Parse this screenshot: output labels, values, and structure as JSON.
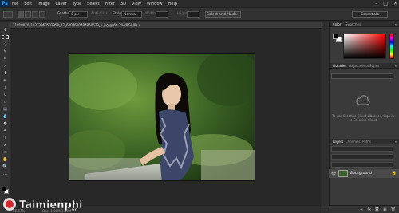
{
  "app": {
    "logo": "Ps"
  },
  "menu": [
    "File",
    "Edit",
    "Image",
    "Layer",
    "Type",
    "Select",
    "Filter",
    "3D",
    "View",
    "Window",
    "Help"
  ],
  "window_controls": [
    "–",
    "□",
    "✕"
  ],
  "options": {
    "feather_label": "Feather:",
    "feather_value": "0 px",
    "antialias_label": "Anti-alias",
    "style_label": "Style:",
    "style_value": "Normal",
    "width_label": "Width:",
    "height_label": "Height:",
    "select_mask": "Select and Mask...",
    "workspace": "Essentials"
  },
  "document": {
    "tab_title": "11818870_10273960502958_17_6004600484860679_n.jpg @ 66.7% (RGB/8) ×"
  },
  "status": {
    "zoom": "66.67%",
    "info": "Doc: 1.00M/1.00M"
  },
  "panels": {
    "color_tabs": [
      "Color",
      "Swatches"
    ],
    "library_tabs": [
      "Libraries",
      "Adjustments",
      "Styles"
    ],
    "library_message": "To use Creative Cloud Libraries, Sign in to Creative Cloud",
    "layer_tabs": [
      "Layers",
      "Channels",
      "Paths"
    ],
    "layer_name": "Background"
  },
  "watermark": {
    "text": "Taimienphi",
    "sub": ".vn"
  },
  "colors": {
    "accent": "#31a8ff",
    "foreground": "#000000",
    "background": "#ffffff"
  }
}
